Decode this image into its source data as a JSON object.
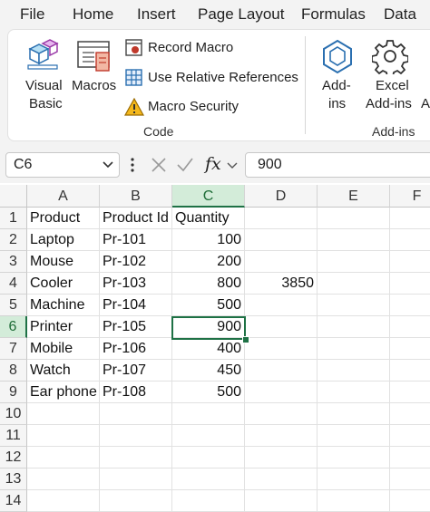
{
  "menu": [
    "File",
    "Home",
    "Insert",
    "Page Layout",
    "Formulas",
    "Data"
  ],
  "ribbon": {
    "visual_basic": [
      "Visual",
      "Basic"
    ],
    "macros": "Macros",
    "record_macro": "Record Macro",
    "use_relative": "Use Relative References",
    "macro_security": "Macro Security",
    "code_group": "Code",
    "addins": [
      "Add-",
      "ins"
    ],
    "excel_addins": [
      "Excel",
      "Add-ins"
    ],
    "partial_next": "A",
    "addins_group": "Add-ins"
  },
  "formula_bar": {
    "name_box": "C6",
    "fx": "fx",
    "value": "900"
  },
  "columns": [
    "A",
    "B",
    "C",
    "D",
    "E",
    "F"
  ],
  "rows": [
    "1",
    "2",
    "3",
    "4",
    "5",
    "6",
    "7",
    "8",
    "9",
    "10",
    "11",
    "12",
    "13",
    "14"
  ],
  "cells": {
    "A1": "Product",
    "B1": "Product Id",
    "C1": "Quantity",
    "A2": "Laptop",
    "B2": "Pr-101",
    "C2": "100",
    "A3": "Mouse",
    "B3": "Pr-102",
    "C3": "200",
    "A4": "Cooler",
    "B4": "Pr-103",
    "C4": "800",
    "D4": "3850",
    "A5": "Machine",
    "B5": "Pr-104",
    "C5": "500",
    "A6": "Printer",
    "B6": "Pr-105",
    "C6": "900",
    "A7": "Mobile",
    "B7": "Pr-106",
    "C7": "400",
    "A8": "Watch",
    "B8": "Pr-107",
    "C8": "450",
    "A9": "Ear phone",
    "B9": "Pr-108",
    "C9": "500"
  },
  "active_cell": "C6",
  "colors": {
    "accent": "#1e7145",
    "header_active": "#d3ecd9"
  }
}
